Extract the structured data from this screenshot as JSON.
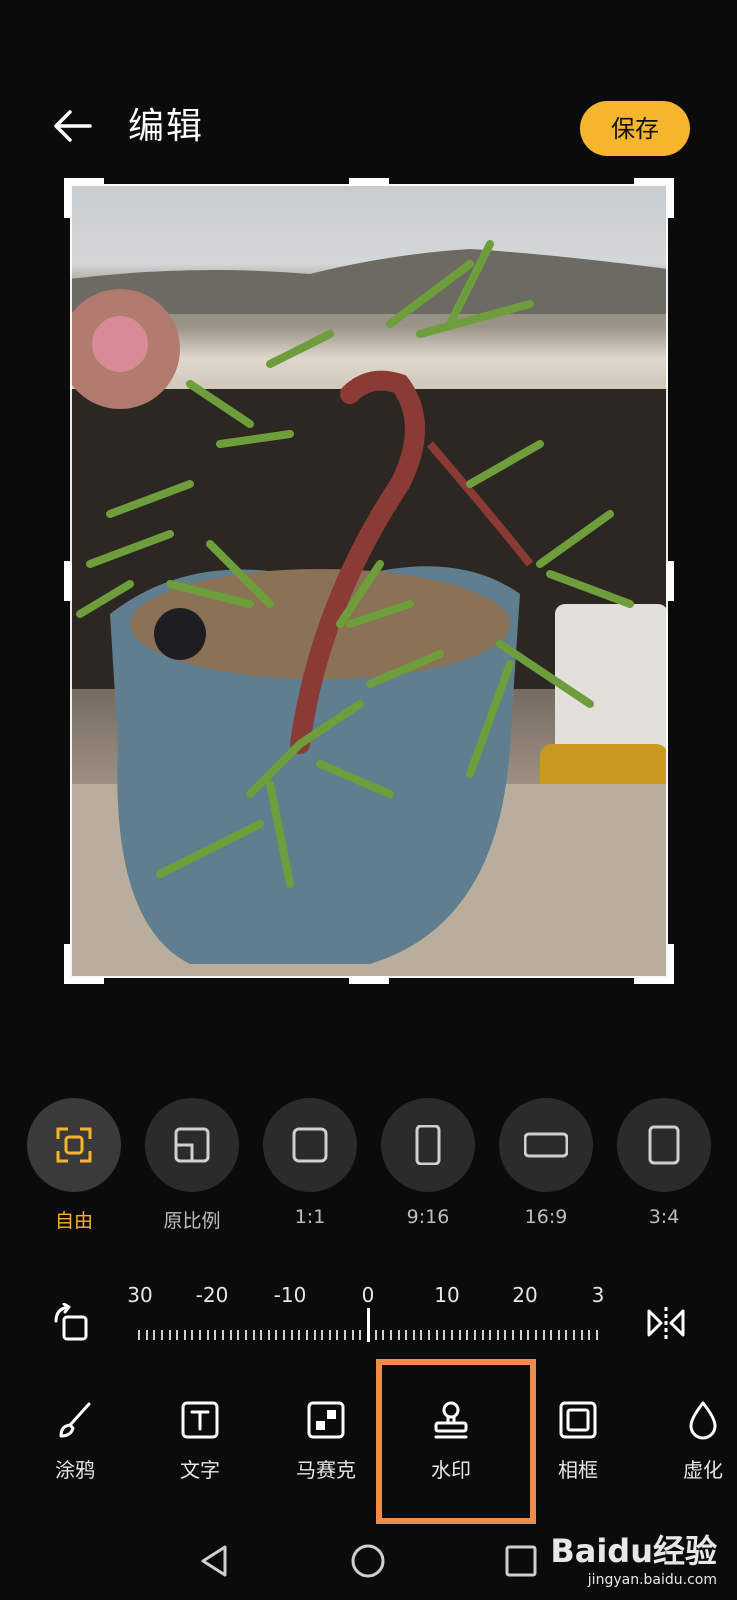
{
  "header": {
    "title": "编辑",
    "save_label": "保存"
  },
  "ratios": [
    {
      "label": "自由",
      "icon": "free-crop-icon",
      "active": true
    },
    {
      "label": "原比例",
      "icon": "original-ratio-icon",
      "active": false
    },
    {
      "label": "1:1",
      "icon": "square-ratio-icon",
      "active": false
    },
    {
      "label": "9:16",
      "icon": "portrait-ratio-icon",
      "active": false
    },
    {
      "label": "16:9",
      "icon": "landscape-ratio-icon",
      "active": false
    },
    {
      "label": "3:4",
      "icon": "three-four-ratio-icon",
      "active": false
    }
  ],
  "ruler": {
    "labels": [
      "30",
      "-20",
      "-10",
      "0",
      "10",
      "20",
      "3"
    ],
    "value": 0
  },
  "tools": [
    {
      "label": "涂鸦",
      "icon": "brush-icon"
    },
    {
      "label": "文字",
      "icon": "text-icon"
    },
    {
      "label": "马赛克",
      "icon": "mosaic-icon"
    },
    {
      "label": "水印",
      "icon": "watermark-stamp-icon"
    },
    {
      "label": "相框",
      "icon": "frame-icon"
    },
    {
      "label": "虚化",
      "icon": "blur-drop-icon"
    }
  ],
  "watermark": {
    "brand": "Baidu经验",
    "url": "jingyan.baidu.com"
  },
  "colors": {
    "accent": "#f6b52c",
    "highlight": "#ef8c47",
    "background": "#0b0b0b"
  }
}
